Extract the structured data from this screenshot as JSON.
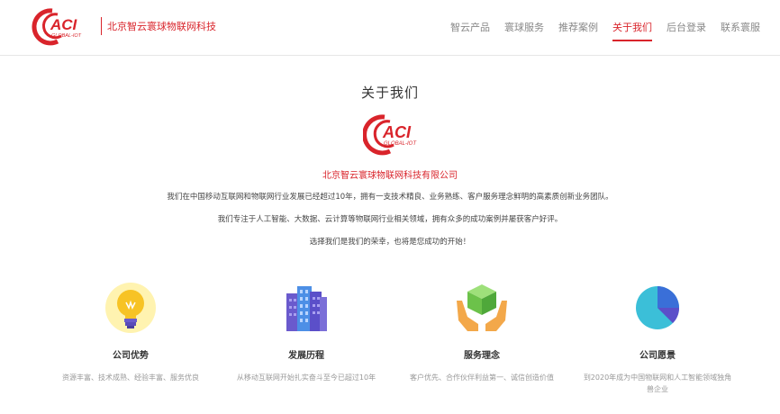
{
  "header": {
    "company_name": "北京智云寰球物联网科技",
    "nav": [
      "智云产品",
      "寰球服务",
      "推荐案例",
      "关于我们",
      "后台登录",
      "联系寰服"
    ],
    "active_index": 3
  },
  "logo": {
    "main": "ACI",
    "sub": "GLOBAL-IOT"
  },
  "about": {
    "title": "关于我们",
    "company_full": "北京智云寰球物联网科技有限公司",
    "paragraphs": [
      "我们在中国移动互联网和物联网行业发展已经超过10年，拥有一支技术精良、业务熟练、客户服务理念鲜明的高素质创新业务团队。",
      "我们专注于人工智能、大数据、云计算等物联网行业相关领域，拥有众多的成功案例并屡获客户好评。",
      "选择我们是我们的荣幸，也将是您成功的开始！"
    ]
  },
  "features": [
    {
      "title": "公司优势",
      "desc": "资源丰富、技术成熟、经验丰富、服务优良",
      "icon": "lightbulb-icon"
    },
    {
      "title": "发展历程",
      "desc": "从移动互联网开始扎实奋斗至今已超过10年",
      "icon": "buildings-icon"
    },
    {
      "title": "服务理念",
      "desc": "客户优先、合作伙伴利益第一、诚信创造价值",
      "icon": "hands-box-icon"
    },
    {
      "title": "公司愿景",
      "desc": "到2020年成为中国物联网和人工智能领域独角兽企业",
      "icon": "pie-chart-icon"
    }
  ],
  "colors": {
    "brand": "#d9242b",
    "nav": "#888888"
  }
}
